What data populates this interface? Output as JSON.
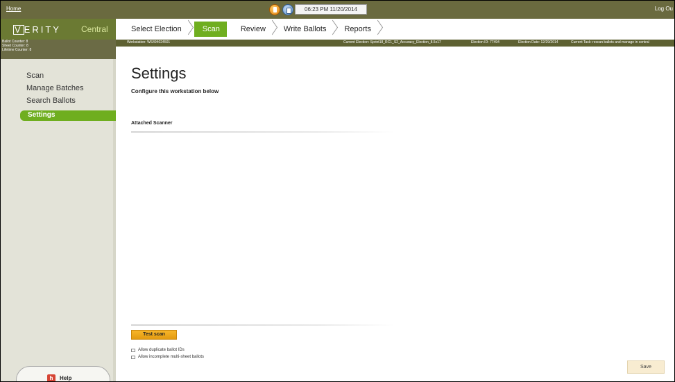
{
  "topbar": {
    "home_label": "Home",
    "logout_label": "Log Ou",
    "clock": "06:23 PM 11/20/2014",
    "icons": [
      "orange-status-icon",
      "blue-status-icon"
    ]
  },
  "brand": {
    "name": "VERITY",
    "product": "Central"
  },
  "tabs": [
    {
      "label": "Select Election",
      "active": false
    },
    {
      "label": "Scan",
      "active": true
    },
    {
      "label": "Review",
      "active": false
    },
    {
      "label": "Write Ballots",
      "active": false
    },
    {
      "label": "Reports",
      "active": false
    }
  ],
  "counters": {
    "ballot": "Ballot Counter: 8",
    "sheet": "Sheet Counter: 8",
    "lifetime": "Lifetime Counter: 8"
  },
  "infostrip": {
    "workstation": "Workstation: WS494024501",
    "current_election": "Current Election: Sprint18_RC1_S2_Accuracy_Election_8.5x17",
    "election_id": "Election ID: 77494",
    "election_date": "Election Date: 12/29/2014",
    "current_task": "Current Task: rescan ballots and manage in central"
  },
  "sidebar": {
    "items": [
      {
        "label": "Scan",
        "active": false
      },
      {
        "label": "Manage Batches",
        "active": false
      },
      {
        "label": "Search Ballots",
        "active": false
      },
      {
        "label": "Settings",
        "active": true
      }
    ],
    "help_label": "Help"
  },
  "main": {
    "title": "Settings",
    "subtitle": "Configure this workstation below",
    "section_label": "Attached Scanner",
    "test_scan_label": "Test scan",
    "options": [
      {
        "label": "Allow duplicate ballot IDs",
        "checked": false
      },
      {
        "label": "Allow incomplete multi-sheet ballots",
        "checked": false
      }
    ],
    "save_label": "Save"
  },
  "colors": {
    "accent_green": "#6fae1f",
    "brand_olive": "#6b7a33",
    "topbar": "#6a6a3f",
    "test_button": "#f7b52a"
  }
}
